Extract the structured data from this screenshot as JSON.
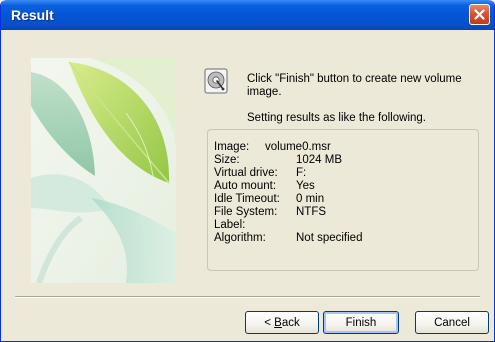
{
  "window": {
    "title": "Result"
  },
  "icons": {
    "disk": "hard-disk-icon",
    "close": "close-icon"
  },
  "content": {
    "intro": "Click \"Finish\" button to create new volume image.",
    "subhead": "Setting results as like the following."
  },
  "results": {
    "image_label": "Image:",
    "image_value": "volume0.msr",
    "rows": [
      {
        "label": "Size:",
        "value": "1024 MB"
      },
      {
        "label": "Virtual drive:",
        "value": "F:"
      },
      {
        "label": "Auto mount:",
        "value": "Yes"
      },
      {
        "label": "Idle Timeout:",
        "value": "0 min"
      },
      {
        "label": "File System:",
        "value": "NTFS"
      },
      {
        "label": "Label:",
        "value": ""
      },
      {
        "label": "Algorithm:",
        "value": "Not specified"
      }
    ]
  },
  "buttons": {
    "back_prefix": "< ",
    "back_mnemonic": "B",
    "back_rest": "ack",
    "finish": "Finish",
    "cancel": "Cancel"
  },
  "colors": {
    "titlebar": "#0454d4",
    "close": "#d9532f",
    "dialog_bg": "#ece9d8",
    "button_border": "#003c74"
  }
}
